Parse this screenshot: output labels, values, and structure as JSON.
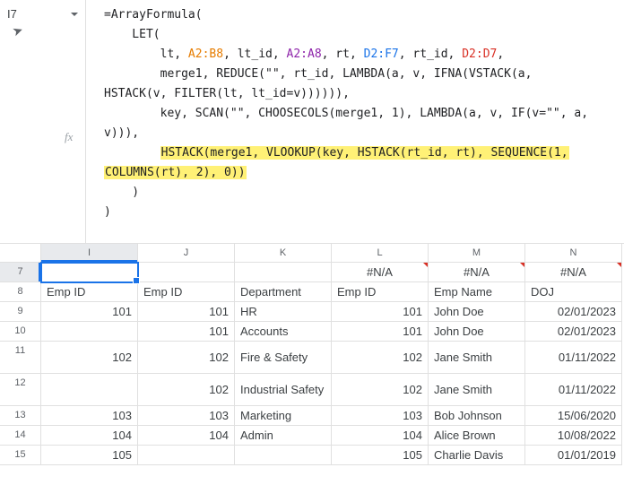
{
  "namebox": {
    "ref": "I7"
  },
  "formula": {
    "line0": "=ArrayFormula(",
    "line1_indent": "    LET(",
    "line2_pre": "        lt, ",
    "line2_ref1": "A2:B8",
    "line2_mid1": ", lt_id, ",
    "line2_ref2": "A2:A8",
    "line2_mid2": ", rt, ",
    "line2_ref3": "D2:F7",
    "line2_mid3": ", rt_id, ",
    "line2_ref4": "D2:D7",
    "line2_end": ",",
    "line3": "        merge1, REDUCE(\"\", rt_id, LAMBDA(a, v, IFNA(VSTACK(a,",
    "line4": "HSTACK(v, FILTER(lt, lt_id=v)))))),",
    "line5": "        key, SCAN(\"\", CHOOSECOLS(merge1, 1), LAMBDA(a, v, IF(v=\"\", a,",
    "line6": "v))),",
    "line7_hl1": "HSTACK(merge1, VLOOKUP(key, HSTACK(rt_id, rt), SEQUENCE(1,",
    "line8_hl2": "COLUMNS(rt), 2), 0))",
    "line9": "    )",
    "line10": ")"
  },
  "fx_label": "fx",
  "columns": [
    "I",
    "J",
    "K",
    "L",
    "M",
    "N"
  ],
  "active_column": "I",
  "active_row": "7",
  "rows": [
    {
      "num": "7",
      "tall": false,
      "I": "",
      "J": "",
      "K": "",
      "L": "#N/A",
      "M": "#N/A",
      "N": "#N/A",
      "numL": false,
      "numM": false
    },
    {
      "num": "8",
      "tall": false,
      "I": "Emp ID",
      "J": "Emp ID",
      "K": "Department",
      "L": "Emp ID",
      "M": "Emp Name",
      "N": "DOJ"
    },
    {
      "num": "9",
      "tall": false,
      "I": "101",
      "J": "101",
      "K": "HR",
      "L": "101",
      "M": "John Doe",
      "N": "02/01/2023",
      "numL": true,
      "numM": false,
      "numI": true,
      "numJ": true
    },
    {
      "num": "10",
      "tall": false,
      "I": "",
      "J": "101",
      "K": "Accounts",
      "L": "101",
      "M": "John Doe",
      "N": "02/01/2023",
      "numL": true,
      "numJ": true
    },
    {
      "num": "11",
      "tall": true,
      "I": "102",
      "J": "102",
      "K": "Fire & Safety",
      "L": "102",
      "M": "Jane Smith",
      "N": "01/11/2022",
      "numI": true,
      "numJ": true,
      "numL": true
    },
    {
      "num": "12",
      "tall": true,
      "I": "",
      "J": "102",
      "K": "Industrial Safety",
      "L": "102",
      "M": "Jane Smith",
      "N": "01/11/2022",
      "numJ": true,
      "numL": true
    },
    {
      "num": "13",
      "tall": false,
      "I": "103",
      "J": "103",
      "K": "Marketing",
      "L": "103",
      "M": "Bob Johnson",
      "N": "15/06/2020",
      "numI": true,
      "numJ": true,
      "numL": true
    },
    {
      "num": "14",
      "tall": false,
      "I": "104",
      "J": "104",
      "K": "Admin",
      "L": "104",
      "M": "Alice Brown",
      "N": "10/08/2022",
      "numI": true,
      "numJ": true,
      "numL": true
    },
    {
      "num": "15",
      "tall": false,
      "I": "105",
      "J": "",
      "K": "",
      "L": "105",
      "M": "Charlie Davis",
      "N": "01/01/2019",
      "numI": true,
      "numL": true
    }
  ]
}
